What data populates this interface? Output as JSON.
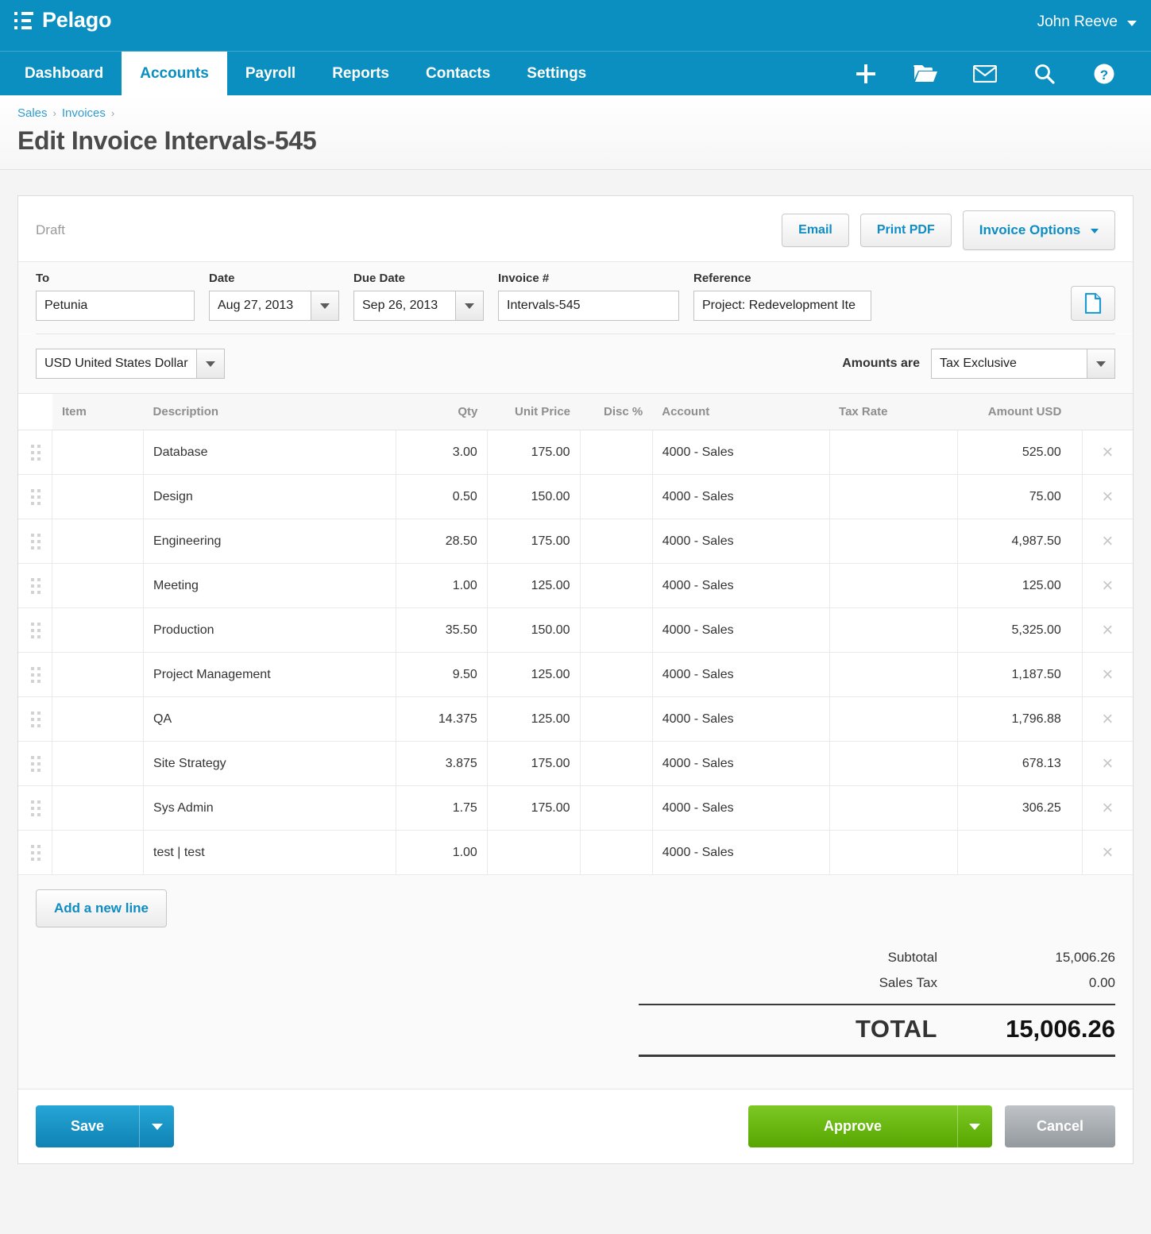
{
  "app": {
    "brand": "Pelago",
    "menu_icon": "list-menu-icon",
    "user": "John Reeve"
  },
  "nav": {
    "tabs": [
      {
        "label": "Dashboard",
        "active": false
      },
      {
        "label": "Accounts",
        "active": true
      },
      {
        "label": "Payroll",
        "active": false
      },
      {
        "label": "Reports",
        "active": false
      },
      {
        "label": "Contacts",
        "active": false
      },
      {
        "label": "Settings",
        "active": false
      }
    ],
    "icons": [
      "plus-icon",
      "folder-open-icon",
      "envelope-icon",
      "search-icon",
      "help-icon"
    ]
  },
  "breadcrumb": {
    "items": [
      "Sales",
      "Invoices"
    ],
    "separator": "›"
  },
  "page": {
    "title": "Edit Invoice Intervals-545"
  },
  "card": {
    "status": "Draft",
    "actions": {
      "email": "Email",
      "print_pdf": "Print PDF",
      "invoice_options": "Invoice Options",
      "document_icon": "document-copy-icon"
    }
  },
  "form": {
    "to": {
      "label": "To",
      "value": "Petunia",
      "placeholder": ""
    },
    "date": {
      "label": "Date",
      "value": "Aug 27, 2013"
    },
    "due_date": {
      "label": "Due Date",
      "value": "Sep 26, 2013"
    },
    "invoice_no": {
      "label": "Invoice #",
      "value": "Intervals-545"
    },
    "reference": {
      "label": "Reference",
      "value": "Project: Redevelopment Ite"
    },
    "currency": {
      "value": "USD United States Dollar"
    },
    "amounts_are": {
      "label": "Amounts are",
      "value": "Tax Exclusive"
    }
  },
  "table": {
    "columns": [
      "Item",
      "Description",
      "Qty",
      "Unit Price",
      "Disc %",
      "Account",
      "Tax Rate",
      "Amount USD"
    ],
    "rows": [
      {
        "item": "",
        "description": "Database",
        "qty": "3.00",
        "unit_price": "175.00",
        "disc": "",
        "account": "4000 - Sales",
        "tax_rate": "",
        "amount": "525.00"
      },
      {
        "item": "",
        "description": "Design",
        "qty": "0.50",
        "unit_price": "150.00",
        "disc": "",
        "account": "4000 - Sales",
        "tax_rate": "",
        "amount": "75.00"
      },
      {
        "item": "",
        "description": "Engineering",
        "qty": "28.50",
        "unit_price": "175.00",
        "disc": "",
        "account": "4000 - Sales",
        "tax_rate": "",
        "amount": "4,987.50"
      },
      {
        "item": "",
        "description": "Meeting",
        "qty": "1.00",
        "unit_price": "125.00",
        "disc": "",
        "account": "4000 - Sales",
        "tax_rate": "",
        "amount": "125.00"
      },
      {
        "item": "",
        "description": "Production",
        "qty": "35.50",
        "unit_price": "150.00",
        "disc": "",
        "account": "4000 - Sales",
        "tax_rate": "",
        "amount": "5,325.00"
      },
      {
        "item": "",
        "description": "Project Management",
        "qty": "9.50",
        "unit_price": "125.00",
        "disc": "",
        "account": "4000 - Sales",
        "tax_rate": "",
        "amount": "1,187.50"
      },
      {
        "item": "",
        "description": "QA",
        "qty": "14.375",
        "unit_price": "125.00",
        "disc": "",
        "account": "4000 - Sales",
        "tax_rate": "",
        "amount": "1,796.88"
      },
      {
        "item": "",
        "description": "Site Strategy",
        "qty": "3.875",
        "unit_price": "175.00",
        "disc": "",
        "account": "4000 - Sales",
        "tax_rate": "",
        "amount": "678.13"
      },
      {
        "item": "",
        "description": "Sys Admin",
        "qty": "1.75",
        "unit_price": "175.00",
        "disc": "",
        "account": "4000 - Sales",
        "tax_rate": "",
        "amount": "306.25"
      },
      {
        "item": "",
        "description": "test | test",
        "qty": "1.00",
        "unit_price": "",
        "disc": "",
        "account": "4000 - Sales",
        "tax_rate": "",
        "amount": ""
      }
    ],
    "add_line_label": "Add a new line"
  },
  "totals": {
    "subtotal_label": "Subtotal",
    "subtotal_value": "15,006.26",
    "tax_label": "Sales Tax",
    "tax_value": "0.00",
    "total_label": "TOTAL",
    "total_value": "15,006.26"
  },
  "footer": {
    "save": "Save",
    "approve": "Approve",
    "cancel": "Cancel"
  },
  "colors": {
    "brand_blue": "#0a8fc0",
    "link_blue": "#2f9dd2",
    "action_blue": "#0e8cc4",
    "approve_green": "#6ebb14",
    "cancel_gray": "#a3a8ad"
  }
}
